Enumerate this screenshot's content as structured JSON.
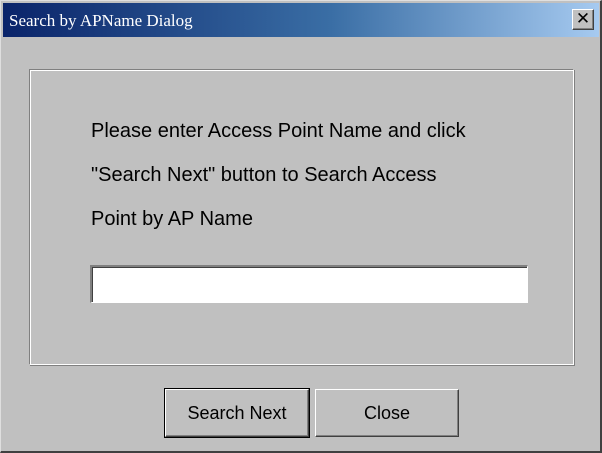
{
  "window": {
    "title": "Search by APName Dialog",
    "close_glyph": "✕"
  },
  "message": {
    "line1": "Please enter Access Point Name and click",
    "line2": "\"Search Next\" button to Search Access",
    "line3": "Point by AP Name"
  },
  "input": {
    "value": ""
  },
  "buttons": {
    "search_next": "Search Next",
    "close": "Close"
  },
  "icons": {
    "close": "close-icon"
  }
}
